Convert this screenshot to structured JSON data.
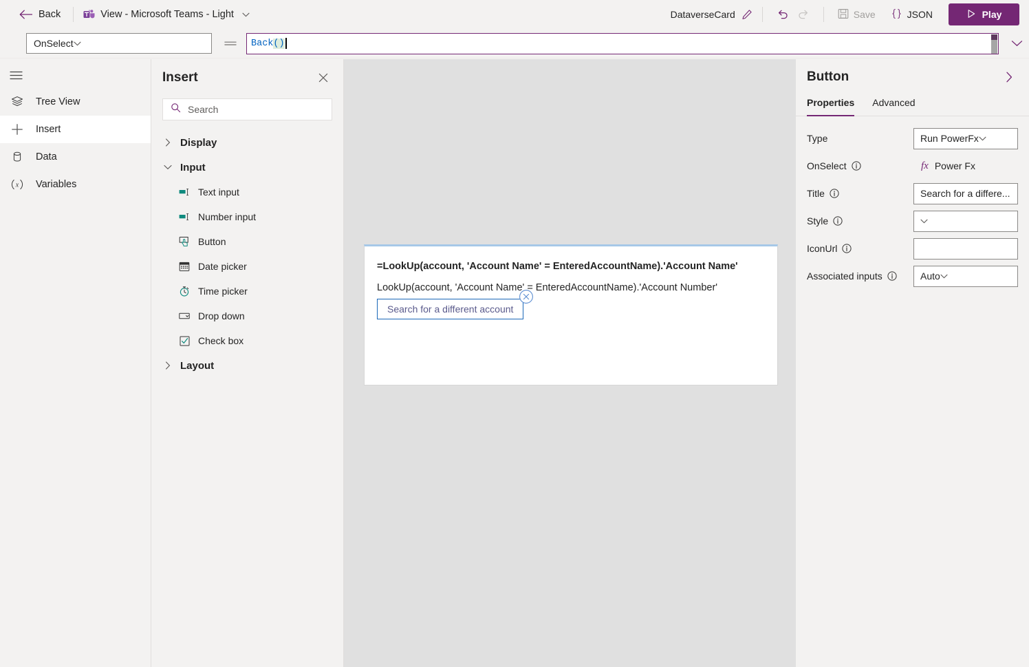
{
  "topbar": {
    "back_label": "Back",
    "back_icon": "arrow-left-icon",
    "teams_icon": "microsoft-teams-icon",
    "view_label": "View - Microsoft Teams - Light",
    "view_chevron_icon": "chevron-down-icon",
    "card_name": "DataverseCard",
    "pencil_icon": "pencil-edit-icon",
    "undo_icon": "undo-icon",
    "redo_icon": "redo-icon",
    "save_label": "Save",
    "save_icon": "save-floppy-icon",
    "json_label": "JSON",
    "json_icon": "curly-braces-icon",
    "play_label": "Play",
    "play_icon": "play-triangle-icon",
    "accent_color": "#742774"
  },
  "formula_bar": {
    "property_selected": "OnSelect",
    "property_chevron_icon": "chevron-down-icon",
    "equals_sign": "=",
    "formula_prefix": "Back",
    "formula_parens": "()",
    "expand_icon": "chevron-down-icon",
    "border_color": "#742774",
    "token_color": "#0062c1"
  },
  "rail": {
    "hamburger_icon": "hamburger-menu-icon",
    "items": [
      {
        "label": "Tree View",
        "icon": "layers-tree-icon",
        "active": false
      },
      {
        "label": "Insert",
        "icon": "plus-icon",
        "active": true
      },
      {
        "label": "Data",
        "icon": "database-cylinder-icon",
        "active": false
      },
      {
        "label": "Variables",
        "icon": "variable-x-icon",
        "active": false
      }
    ]
  },
  "insert_panel": {
    "title": "Insert",
    "close_icon": "close-x-icon",
    "search": {
      "placeholder": "Search",
      "value": "",
      "icon": "search-icon"
    },
    "groups": [
      {
        "label": "Display",
        "expanded": false,
        "chevron_icon": "chevron-right-icon",
        "items": []
      },
      {
        "label": "Input",
        "expanded": true,
        "chevron_icon": "chevron-down-icon",
        "items": [
          {
            "label": "Text input",
            "icon": "text-input-icon"
          },
          {
            "label": "Number input",
            "icon": "number-input-icon"
          },
          {
            "label": "Button",
            "icon": "button-click-icon"
          },
          {
            "label": "Date picker",
            "icon": "calendar-icon"
          },
          {
            "label": "Time picker",
            "icon": "clock-icon"
          },
          {
            "label": "Drop down",
            "icon": "dropdown-icon"
          },
          {
            "label": "Check box",
            "icon": "checkbox-icon"
          }
        ]
      },
      {
        "label": "Layout",
        "expanded": false,
        "chevron_icon": "chevron-right-icon",
        "items": []
      }
    ]
  },
  "canvas": {
    "background_color": "#e0e0e0",
    "card": {
      "accent_border_color": "#a6c8e8",
      "line1": "=LookUp(account, 'Account Name' = EnteredAccountName).'Account Name'",
      "line2": "LookUp(account, 'Account Name' = EnteredAccountName).'Account Number'",
      "button_label": "Search for a different account",
      "button_border_color": "#1967b8",
      "delete_badge_icon": "circle-x-delete-icon"
    }
  },
  "right_panel": {
    "title": "Button",
    "collapse_icon": "chevron-right-icon",
    "tabs": [
      {
        "label": "Properties",
        "active": true
      },
      {
        "label": "Advanced",
        "active": false
      }
    ],
    "properties": [
      {
        "label": "Type",
        "info": false,
        "control": "select",
        "value": "Run PowerFx",
        "chevron_icon": "chevron-down-icon"
      },
      {
        "label": "OnSelect",
        "info": true,
        "control": "formula",
        "value": "Power Fx",
        "fx_icon": "fx-icon"
      },
      {
        "label": "Title",
        "info": true,
        "control": "input",
        "value": "Search for a differe..."
      },
      {
        "label": "Style",
        "info": true,
        "control": "select",
        "value": "",
        "chevron_icon": "chevron-down-icon"
      },
      {
        "label": "IconUrl",
        "info": true,
        "control": "input",
        "value": ""
      },
      {
        "label": "Associated inputs",
        "info": true,
        "control": "select",
        "value": "Auto",
        "chevron_icon": "chevron-down-icon"
      }
    ],
    "info_icon": "info-circle-icon"
  }
}
